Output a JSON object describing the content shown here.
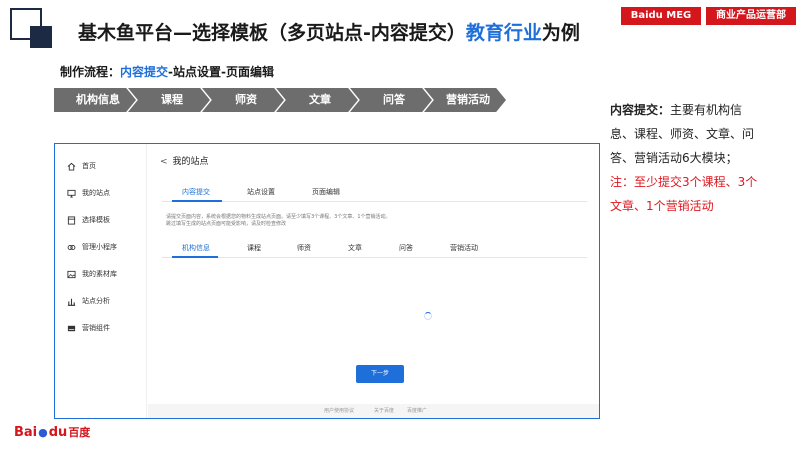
{
  "header": {
    "title_main": "基木鱼平台—选择模板（多页站点-内容提交）",
    "title_highlight": "教育行业",
    "title_tail": "为例",
    "badge_left": "Baidu MEG",
    "badge_right": "商业产品运营部"
  },
  "process": {
    "label": "制作流程：",
    "current": "内容提交",
    "rest": "-站点设置-页面编辑",
    "steps": [
      "机构信息",
      "课程",
      "师资",
      "文章",
      "问答",
      "营销活动"
    ]
  },
  "note": {
    "label": "内容提交：",
    "body": "主要有机构信息、课程、师资、文章、问答、营销活动6大模块；",
    "warning": "注：至少提交3个课程、3个文章、1个营销活动"
  },
  "app": {
    "sidebar": [
      {
        "label": "首页",
        "icon": "home-icon"
      },
      {
        "label": "我的站点",
        "icon": "monitor-icon"
      },
      {
        "label": "选择模板",
        "icon": "template-icon"
      },
      {
        "label": "管理小程序",
        "icon": "mini-program-icon"
      },
      {
        "label": "我的素材库",
        "icon": "image-icon"
      },
      {
        "label": "站点分析",
        "icon": "bar-chart-icon"
      },
      {
        "label": "营销组件",
        "icon": "component-icon"
      }
    ],
    "page_title": "我的站点",
    "top_tabs": [
      "内容提交",
      "站点设置",
      "页面编辑"
    ],
    "description_line1": "请提交页面内容，系统会根据您的物料生成站点页面。请至少填写3个课程、3个文章、1个营销活动。",
    "description_line2": "跳过填写生成的站点页面可能受影响，请及时检查修改",
    "sub_tabs": [
      "机构信息",
      "课程",
      "师资",
      "文章",
      "问答",
      "营销活动"
    ],
    "next_button": "下一步",
    "footer_links": [
      "用户使用协议",
      "关于百度",
      "百度推广"
    ]
  },
  "logo": {
    "bai": "Bai",
    "du": "du",
    "cn": "百度"
  },
  "colors": {
    "accent": "#1e6fd9",
    "brand_red": "#d4161d",
    "step_gray": "#6d6d6d",
    "dark_navy": "#1d2a44"
  }
}
